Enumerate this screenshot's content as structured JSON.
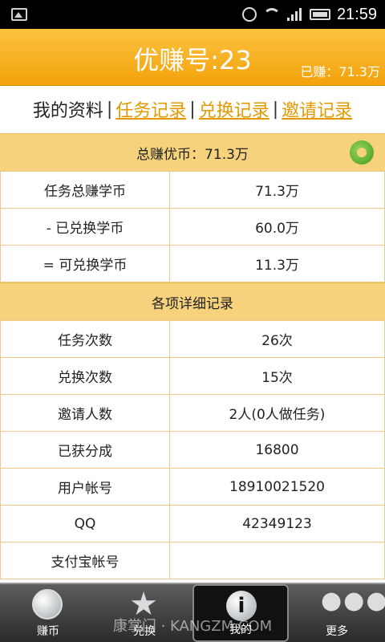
{
  "status_bar": {
    "time": "21:59"
  },
  "header": {
    "title": "优赚号:23",
    "earned": "已赚：71.3万"
  },
  "tabs": {
    "my_profile": "我的资料",
    "sep": "|",
    "task_records": "任务记录",
    "exchange_records": "兑换记录",
    "invite_records": "邀请记录"
  },
  "summary": {
    "total_label": "总赚优币：71.3万",
    "rows": [
      {
        "label": "任务总赚学币",
        "value": "71.3万"
      },
      {
        "label": "-  已兑换学币",
        "value": "60.0万"
      },
      {
        "label": "= 可兑换学币",
        "value": "11.3万"
      }
    ]
  },
  "details": {
    "section_label": "各项详细记录",
    "rows": [
      {
        "label": "任务次数",
        "value": "26次"
      },
      {
        "label": "兑换次数",
        "value": "15次"
      },
      {
        "label": "邀请人数",
        "value": "2人(0人做任务)"
      },
      {
        "label": "已获分成",
        "value": "16800"
      },
      {
        "label": "用户帐号",
        "value": "18910021520"
      },
      {
        "label": "QQ",
        "value": "42349123"
      },
      {
        "label": "支付宝帐号",
        "value": ""
      }
    ]
  },
  "bottom_nav": {
    "items": [
      {
        "label": "赚币",
        "icon": "globe-icon"
      },
      {
        "label": "兑换",
        "icon": "star-icon"
      },
      {
        "label": "我的",
        "icon": "info-icon"
      },
      {
        "label": "更多",
        "icon": "more-icon"
      }
    ],
    "active_index": 2
  },
  "watermark": "康掌门 · KANGZM.COM",
  "colors": {
    "accent": "#f3a20a",
    "section_bg": "#f5d27b",
    "link": "#e39a00"
  }
}
